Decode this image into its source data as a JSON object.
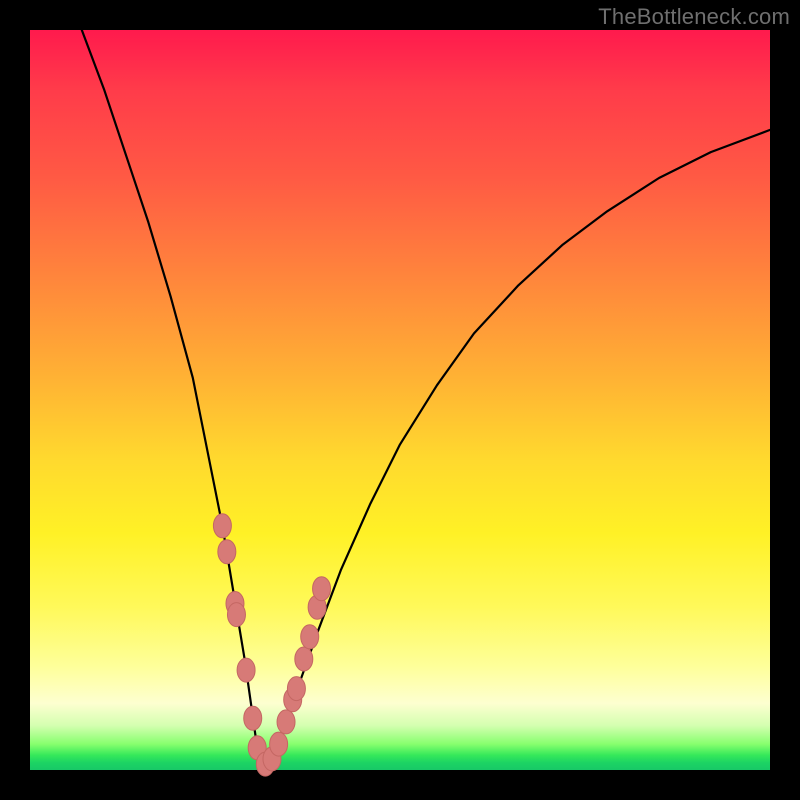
{
  "watermark": {
    "text": "TheBottleneck.com"
  },
  "colors": {
    "frame": "#000000",
    "curve_stroke": "#000000",
    "marker_fill": "#d77a77",
    "marker_stroke": "#c46763"
  },
  "chart_data": {
    "type": "line",
    "title": "",
    "xlabel": "",
    "ylabel": "",
    "xlim": [
      0,
      100
    ],
    "ylim": [
      0,
      100
    ],
    "grid": false,
    "legend": false,
    "series": [
      {
        "name": "bottleneck-curve",
        "x": [
          7,
          10,
          13,
          16,
          19,
          22,
          24,
          26,
          27.5,
          29,
          30,
          30.7,
          31.3,
          32,
          33,
          34.5,
          36.5,
          39,
          42,
          46,
          50,
          55,
          60,
          66,
          72,
          78,
          85,
          92,
          100
        ],
        "y": [
          100,
          92,
          83,
          74,
          64,
          53,
          43,
          33,
          24,
          15,
          8,
          3,
          0.8,
          0.6,
          2,
          6,
          12,
          19,
          27,
          36,
          44,
          52,
          59,
          65.5,
          71,
          75.5,
          80,
          83.5,
          86.5
        ]
      }
    ],
    "markers": {
      "name": "highlighted-points",
      "x": [
        26.0,
        26.6,
        27.7,
        27.9,
        29.2,
        30.1,
        30.7,
        31.8,
        32.7,
        33.6,
        34.6,
        35.5,
        36.0,
        37.0,
        37.8,
        38.8,
        39.4
      ],
      "y": [
        33.0,
        29.5,
        22.5,
        21.0,
        13.5,
        7.0,
        3.0,
        0.8,
        1.5,
        3.5,
        6.5,
        9.5,
        11.0,
        15.0,
        18.0,
        22.0,
        24.5
      ]
    }
  }
}
